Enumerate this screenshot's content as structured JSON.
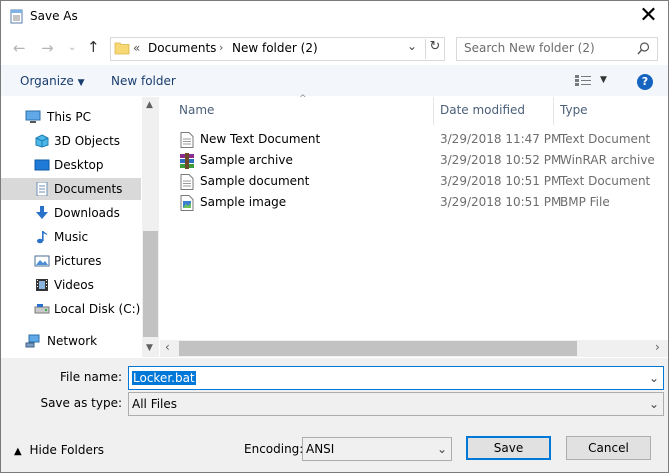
{
  "window": {
    "title": "Save As"
  },
  "address": {
    "overflow": "«",
    "segments": [
      "Documents",
      "New folder (2)"
    ]
  },
  "search": {
    "placeholder": "Search New folder (2)"
  },
  "toolbar": {
    "organize_label": "Organize",
    "new_folder_label": "New folder"
  },
  "nav": {
    "items": [
      {
        "label": "This PC",
        "icon": "computer-icon",
        "selected": false
      },
      {
        "label": "3D Objects",
        "icon": "cube-icon",
        "selected": false
      },
      {
        "label": "Desktop",
        "icon": "desktop-icon",
        "selected": false
      },
      {
        "label": "Documents",
        "icon": "documents-icon",
        "selected": true
      },
      {
        "label": "Downloads",
        "icon": "download-arrow-icon",
        "selected": false
      },
      {
        "label": "Music",
        "icon": "music-note-icon",
        "selected": false
      },
      {
        "label": "Pictures",
        "icon": "pictures-icon",
        "selected": false
      },
      {
        "label": "Videos",
        "icon": "film-icon",
        "selected": false
      },
      {
        "label": "Local Disk (C:)",
        "icon": "drive-icon",
        "selected": false
      },
      {
        "label": "Network",
        "icon": "network-icon",
        "selected": false
      }
    ]
  },
  "files": {
    "columns": {
      "name": "Name",
      "date": "Date modified",
      "type": "Type"
    },
    "rows": [
      {
        "name": "New Text Document",
        "date": "3/29/2018 11:47 PM",
        "type": "Text Document",
        "icon": "text-file-icon"
      },
      {
        "name": "Sample archive",
        "date": "3/29/2018 10:52 PM",
        "type": "WinRAR archive",
        "icon": "winrar-icon"
      },
      {
        "name": "Sample document",
        "date": "3/29/2018 10:51 PM",
        "type": "Text Document",
        "icon": "text-file-icon"
      },
      {
        "name": "Sample image",
        "date": "3/29/2018 10:51 PM",
        "type": "BMP File",
        "icon": "image-file-icon"
      }
    ]
  },
  "form": {
    "filename_label": "File name:",
    "filename_value": "Locker.bat",
    "savetype_label": "Save as type:",
    "savetype_value": "All Files",
    "encoding_label": "Encoding:",
    "encoding_value": "ANSI",
    "save_label": "Save",
    "cancel_label": "Cancel",
    "hide_folders_label": "Hide Folders"
  },
  "colors": {
    "accent": "#0078d7",
    "selection": "#d9d9d9",
    "link": "#1a3e6e"
  }
}
